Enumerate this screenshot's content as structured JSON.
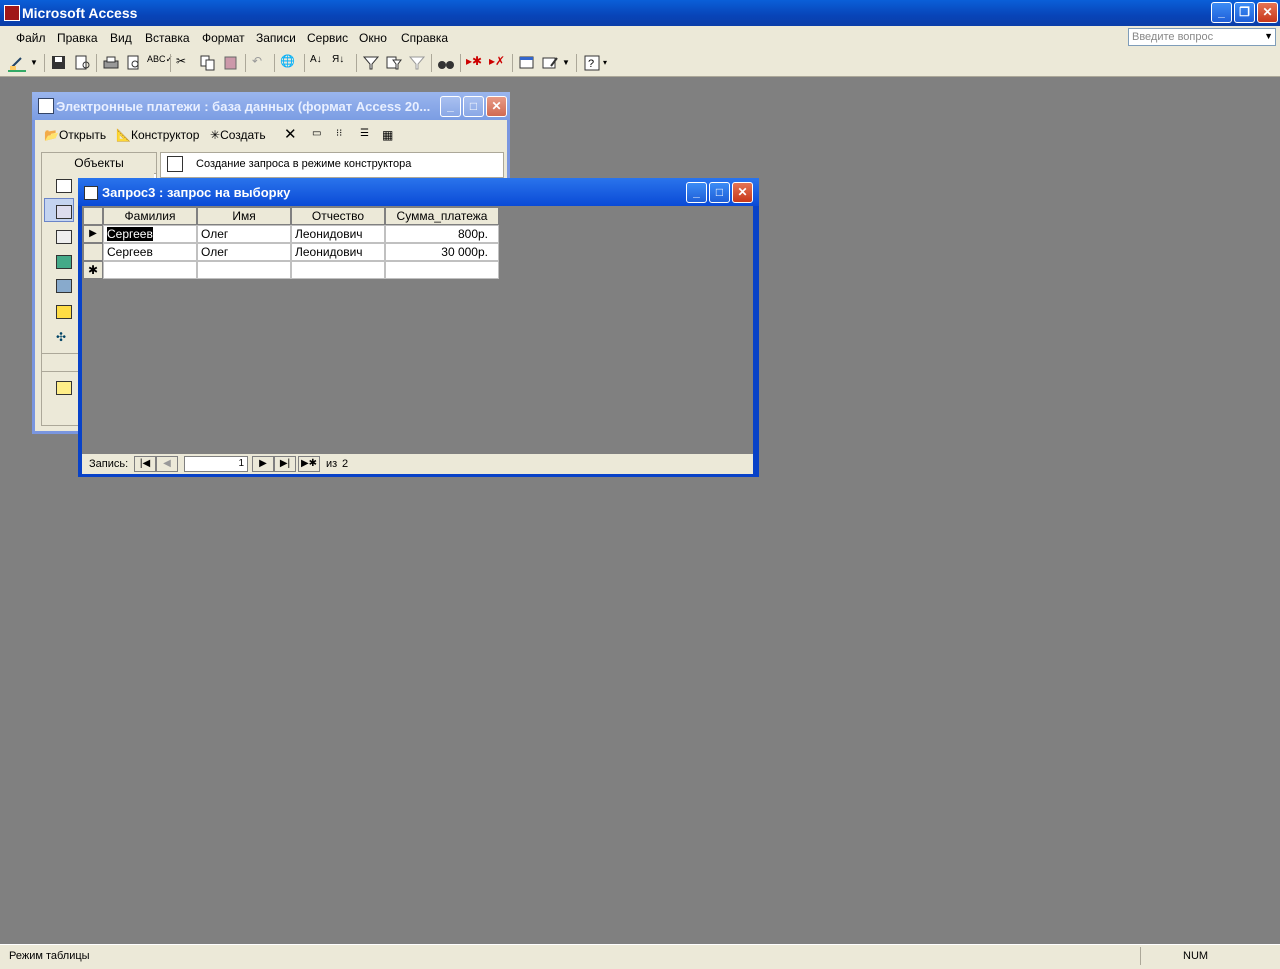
{
  "app": {
    "title": "Microsoft Access"
  },
  "menu": [
    "Файл",
    "Правка",
    "Вид",
    "Вставка",
    "Формат",
    "Записи",
    "Сервис",
    "Окно",
    "Справка"
  ],
  "ask_placeholder": "Введите вопрос",
  "db_window": {
    "title": "Электронные платежи : база данных (формат Access 20...",
    "toolbar": {
      "open": "Открыть",
      "design": "Конструктор",
      "create": "Создать"
    },
    "objects_header": "Объекты",
    "list_item": "Создание запроса в режиме конструктора"
  },
  "query_window": {
    "title": "Запрос3 : запрос на выборку",
    "columns": [
      "Фамилия",
      "Имя",
      "Отчество",
      "Сумма_платежа"
    ],
    "rows": [
      [
        "Сергеев",
        "Олег",
        "Леонидович",
        "800р."
      ],
      [
        "Сергеев",
        "Олег",
        "Леонидович",
        "30 000р."
      ]
    ],
    "nav": {
      "label": "Запись:",
      "current": "1",
      "of": "из",
      "total": "2"
    }
  },
  "status": {
    "mode": "Режим таблицы",
    "num": "NUM"
  }
}
